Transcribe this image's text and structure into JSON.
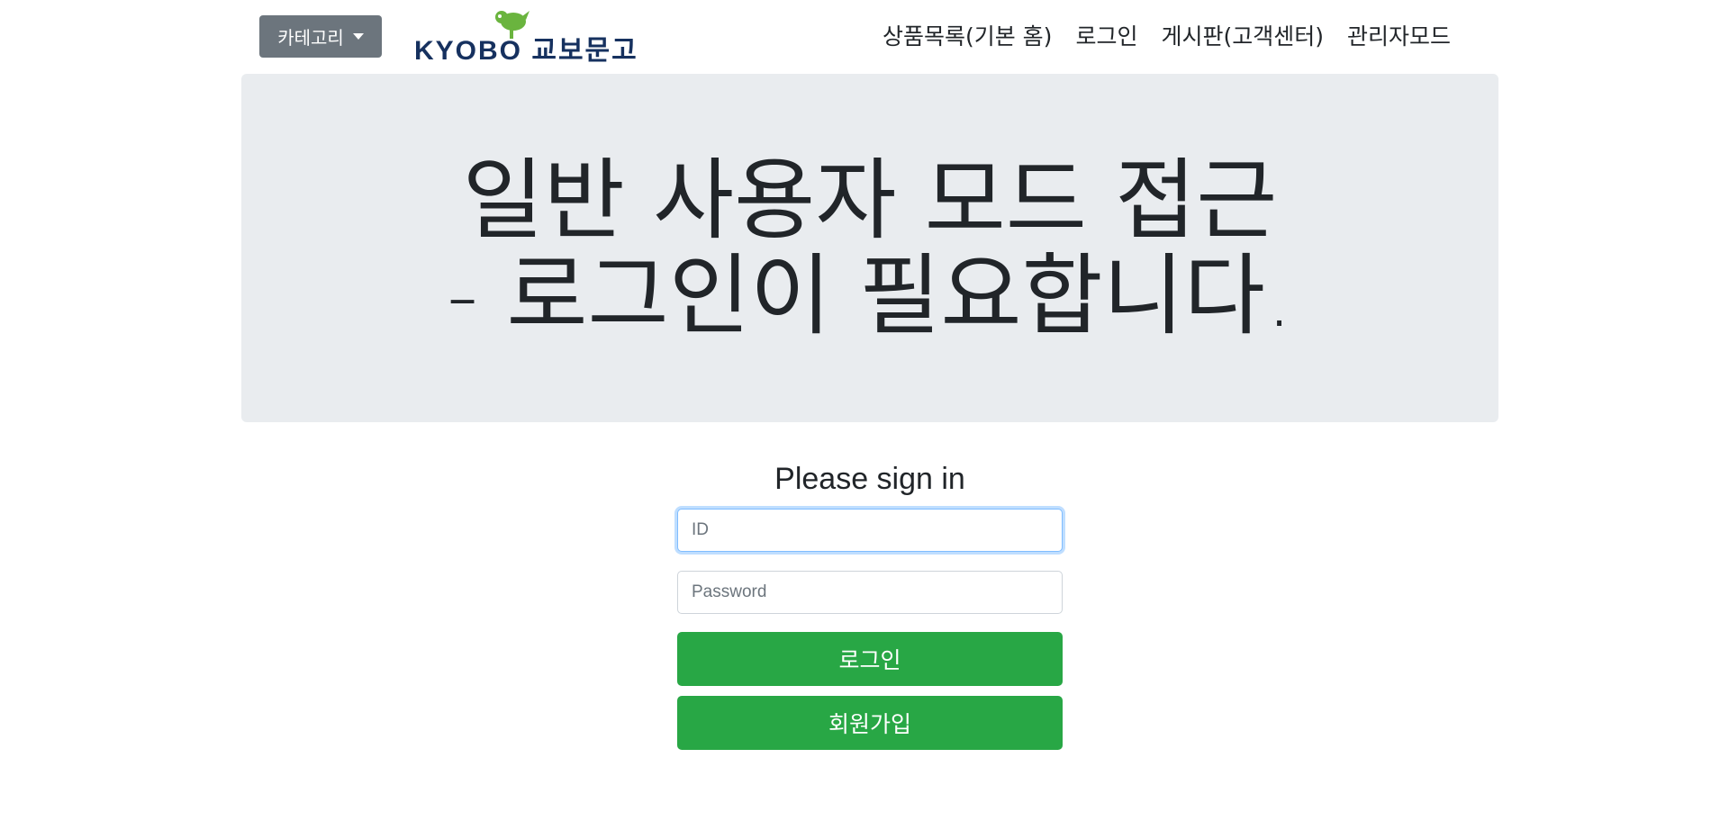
{
  "navbar": {
    "category_button": "카테고리",
    "logo_text": "KYOBO 교보문고",
    "links": [
      "상품목록(기본 홈)",
      "로그인",
      "게시판(고객센터)",
      "관리자모드"
    ]
  },
  "jumbotron": {
    "line1": "일반 사용자 모드 접근",
    "line2": "- 로그인이 필요합니다."
  },
  "signin": {
    "title": "Please sign in",
    "id_placeholder": "ID",
    "password_placeholder": "Password",
    "login_button": "로그인",
    "signup_button": "회원가입"
  },
  "colors": {
    "category_button": "#6c757d",
    "jumbotron_bg": "#e9ecef",
    "primary_green": "#28a745",
    "logo_navy": "#16315f",
    "logo_green": "#6ab43e"
  }
}
